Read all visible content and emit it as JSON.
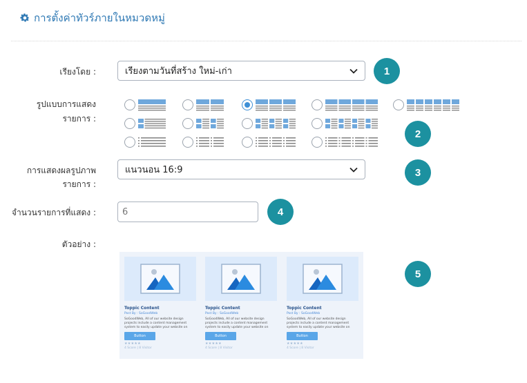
{
  "header": {
    "title": "การตั้งค่าทัวร์ภายในหมวดหมู่",
    "icon": "gear-icon"
  },
  "sort": {
    "label": "เรียงโดย :",
    "value": "เรียงตามวันที่สร้าง ใหม่-เก่า",
    "badge": "1"
  },
  "layout": {
    "label_line1": "รูปแบบการแสดง",
    "label_line2": "รายการ :",
    "badge": "2",
    "selected_index": 2,
    "options": [
      {
        "row": 1,
        "col": 1
      },
      {
        "row": 1,
        "col": 2
      },
      {
        "row": 1,
        "col": 3
      },
      {
        "row": 1,
        "col": 4
      },
      {
        "row": 1,
        "col": 6
      },
      {
        "row": 2,
        "col": 1
      },
      {
        "row": 2,
        "col": 2
      },
      {
        "row": 2,
        "col": 3
      },
      {
        "row": 2,
        "col": 4
      },
      {
        "row": 3,
        "col": 1
      },
      {
        "row": 3,
        "col": 2
      },
      {
        "row": 3,
        "col": 3
      },
      {
        "row": 3,
        "col": 4
      }
    ]
  },
  "image_display": {
    "label_line1": "การแสดงผลรูปภาพ",
    "label_line2": "รายการ :",
    "value": "แนวนอน 16:9",
    "badge": "3"
  },
  "count": {
    "label": "จำนวนรายการที่แสดง :",
    "value": "6",
    "badge": "4"
  },
  "preview": {
    "label": "ตัวอย่าง :",
    "badge": "5",
    "card": {
      "title": "Toppic Content",
      "post_by": "Post By : SoGoodWeb",
      "description": "SoGoodWeb, All of our website design projects include a content management system to easily update your website on",
      "button": "Button",
      "stars": "★★★★★",
      "meta": "4 Score | 8 Visitor"
    }
  },
  "colors": {
    "accent": "#2f79b4",
    "badge": "#1c91a0",
    "radio_checked": "#3d8fd6",
    "thumb_blue": "#6fa8dc",
    "preview_bg": "#eef3fa"
  }
}
